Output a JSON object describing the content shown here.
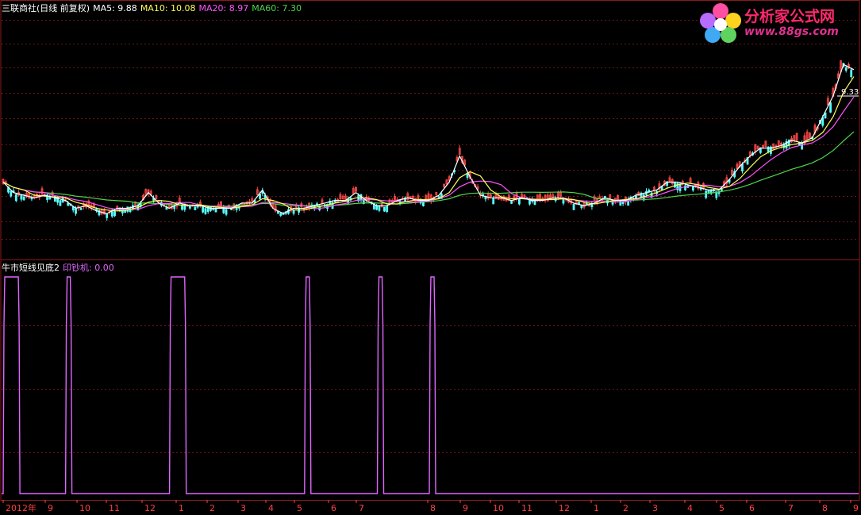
{
  "colors": {
    "background": "#000000",
    "frame": "#8b1a1a",
    "grid": "#6e1414",
    "price_up": "#ff4a4a",
    "price_down": "#56ffff",
    "ma5": "#ffffff",
    "ma10": "#ffff54",
    "ma20": "#ff54ff",
    "ma60": "#4cd64c",
    "signal": "#e066ff",
    "axis_text": "#ff4040"
  },
  "header": {
    "stock_title": "三联商社(日线 前复权)",
    "ma5": "MA5: 9.88",
    "ma10": "MA10: 10.08",
    "ma20": "MA20: 8.97",
    "ma60": "MA60: 7.30"
  },
  "indicator_header": {
    "name": "牛市短线见底2",
    "value": "印钞机: 0.00"
  },
  "watermark": {
    "title": "分析家公式网",
    "url": "www.88gs.com"
  },
  "price_label": "9.33",
  "chart_data": [
    {
      "type": "line",
      "panel": "price",
      "series": [
        {
          "name": "MA5",
          "values": [
            5.2,
            4.8,
            4.7,
            4.6,
            4.7,
            4.6,
            4.5,
            4.2,
            4.3,
            4.1,
            4.0,
            4.2,
            4.2,
            4.3,
            4.8,
            4.4,
            4.2,
            4.4,
            4.3,
            4.3,
            4.2,
            4.2,
            4.2,
            4.4,
            4.4,
            4.9,
            4.2,
            4.0,
            4.2,
            4.2,
            4.3,
            4.4,
            4.5,
            4.5,
            4.8,
            4.5,
            4.3,
            4.3,
            4.5,
            4.6,
            4.5,
            4.5,
            4.7,
            5.2,
            6.2,
            5.4,
            4.7,
            4.6,
            4.6,
            4.5,
            4.6,
            4.5,
            4.5,
            4.6,
            4.6,
            4.4,
            4.3,
            4.4,
            4.6,
            4.5,
            4.5,
            4.7,
            4.8,
            4.9,
            5.2,
            5.2,
            5.1,
            5.0,
            4.9,
            4.9,
            5.3,
            5.8,
            6.2,
            6.5,
            6.5,
            6.6,
            6.8,
            6.7,
            6.9,
            7.7,
            8.5,
            9.7,
            9.5
          ]
        }
      ],
      "y_note": "price, yuan"
    },
    {
      "type": "line",
      "panel": "indicator",
      "title": "牛市短线见底2",
      "series": [
        {
          "name": "印钞机",
          "values": [
            1,
            1,
            0,
            0,
            0,
            0,
            1,
            0,
            0,
            0,
            0,
            0,
            0,
            0,
            0,
            0,
            1,
            1,
            0,
            0,
            0,
            0,
            0,
            0,
            0,
            0,
            0,
            0,
            0,
            1,
            0,
            0,
            0,
            0,
            0,
            0,
            1,
            0,
            0,
            0,
            0,
            1,
            0,
            0,
            0,
            0,
            0,
            0,
            0,
            0,
            0,
            0,
            0,
            0,
            0,
            0,
            0,
            0,
            0,
            0,
            0,
            0,
            0,
            0,
            0,
            0,
            0,
            0,
            0,
            0,
            0,
            0,
            0,
            0,
            0,
            0,
            0,
            0,
            0,
            0,
            0,
            0,
            0
          ]
        }
      ]
    }
  ],
  "x_axis": {
    "labels": [
      "2012年",
      "9",
      "10",
      "11",
      "12",
      "1",
      "2",
      "3",
      "4",
      "5",
      "6",
      "7",
      "8",
      "9",
      "10",
      "11",
      "12",
      "1",
      "2",
      "3",
      "4",
      "5",
      "6",
      "7",
      "8",
      "9"
    ]
  }
}
